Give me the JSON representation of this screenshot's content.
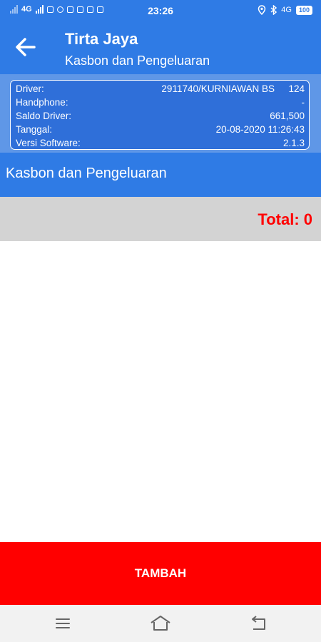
{
  "status_bar": {
    "network": "4G",
    "time": "23:26",
    "battery": "100",
    "network_right": "4G"
  },
  "appbar": {
    "title": "Tirta Jaya",
    "subtitle": "Kasbon dan Pengeluaran",
    "back_icon": "arrow-left-icon"
  },
  "info": {
    "driver_label": "Driver:",
    "driver_value": "2911740/KURNIAWAN BS",
    "driver_extra": "124",
    "handphone_label": "Handphone:",
    "handphone_value": "-",
    "saldo_label": "Saldo Driver:",
    "saldo_value": "661,500",
    "tanggal_label": "Tanggal:",
    "tanggal_value": "20-08-2020 11:26:43",
    "versi_label": "Versi Software:",
    "versi_value": "2.1.3"
  },
  "section": {
    "title": "Kasbon dan Pengeluaran"
  },
  "total": {
    "text": "Total: 0"
  },
  "actions": {
    "tambah_label": "TAMBAH"
  },
  "navbar": {
    "menu_icon": "menu-icon",
    "home_icon": "home-icon",
    "back_icon": "back-icon"
  },
  "colors": {
    "primary": "#2f7be5",
    "info_panel": "#2f6fd9",
    "total_text": "#ff0000",
    "tambah_bg": "#ff0000",
    "total_bar_bg": "#d3d3d3"
  }
}
